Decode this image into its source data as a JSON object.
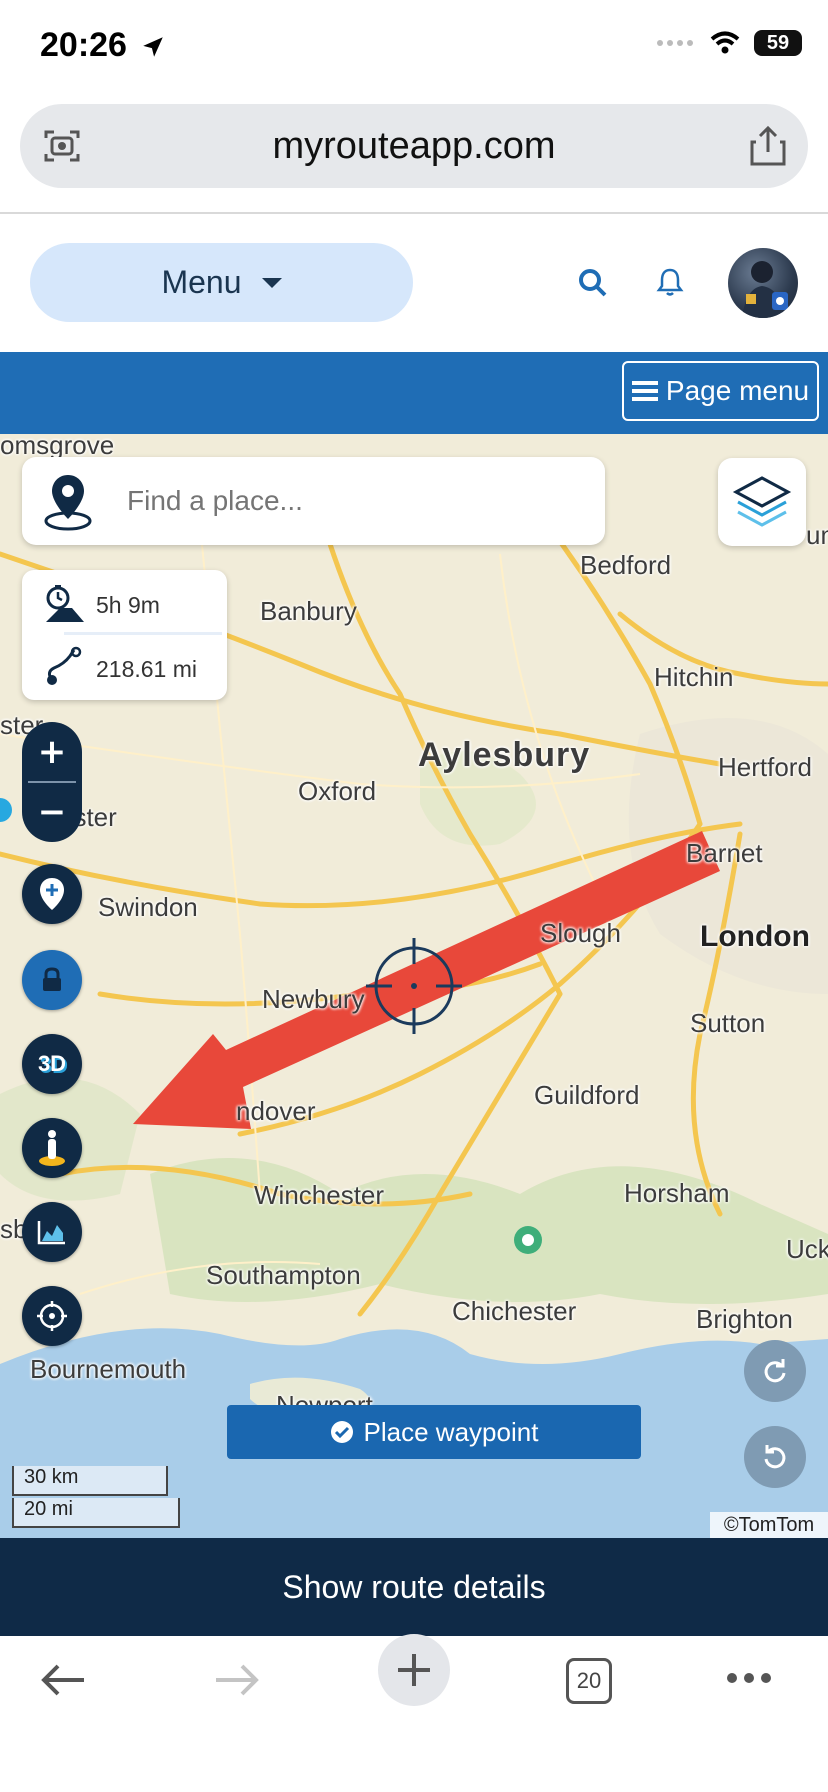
{
  "status_bar": {
    "time": "20:26",
    "battery": "59"
  },
  "browser": {
    "url": "myrouteapp.com",
    "tabs_count": "20"
  },
  "header": {
    "menu_label": "Menu"
  },
  "page_menu": {
    "label": "Page menu"
  },
  "search": {
    "placeholder": "Find a place..."
  },
  "route_summary": {
    "duration": "5h 9m",
    "distance": "218.61 mi"
  },
  "map": {
    "labels": {
      "omsgrove": "omsgrove",
      "bedford": "Bedford",
      "banbury": "Banbury",
      "hitchin": "Hitchin",
      "aylesbury": "Aylesbury",
      "hertford": "Hertford",
      "oxford": "Oxford",
      "cester": "cester",
      "ster": "ster",
      "barnet": "Barnet",
      "swindon": "Swindon",
      "slough": "Slough",
      "london": "London",
      "newbury": "Newbury",
      "sutton": "Sutton",
      "guildford": "Guildford",
      "ndover": "ndover",
      "winchester": "Winchester",
      "horsham": "Horsham",
      "uck": "Uck",
      "southampton": "Southampton",
      "chichester": "Chichester",
      "brighton": "Brighton",
      "bournemouth": "Bournemouth",
      "newport": "Newport",
      "sb": "sb",
      "um": "um"
    },
    "scale_km": "30 km",
    "scale_mi": "20 mi",
    "attribution": "©TomTom"
  },
  "zoom": {
    "in": "+",
    "out": "−"
  },
  "tools": {
    "three_d": "3D"
  },
  "place_waypoint": {
    "label": "Place waypoint"
  },
  "route_details": {
    "label": "Show route details"
  },
  "colors": {
    "primary_blue": "#1f6db5",
    "navy": "#0f2a47",
    "arrow_red": "#e8483a"
  }
}
